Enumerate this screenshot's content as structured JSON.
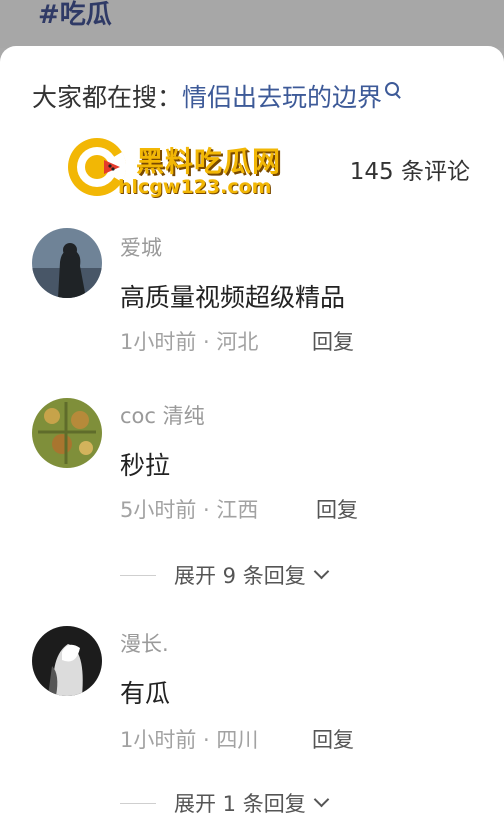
{
  "header": {
    "hashtag": "#吃瓜"
  },
  "search": {
    "prefix": "大家都在搜：",
    "term": "情侣出去玩的边界",
    "icon": "search-icon"
  },
  "watermark": {
    "name": "黑料吃瓜网",
    "url": "hlcgw123.com"
  },
  "comments_header": {
    "count_label": "145 条评论"
  },
  "comments": [
    {
      "username": "爱城",
      "text": "高质量视频超级精品",
      "meta": "1小时前 · 河北",
      "reply": "回复"
    },
    {
      "username": "coc 清纯",
      "text": "秒拉",
      "meta": "5小时前 · 江西",
      "reply": "回复",
      "expand": "展开 9 条回复"
    },
    {
      "username": "漫长.",
      "text": "有瓜",
      "meta": "1小时前 · 四川",
      "reply": "回复",
      "expand": "展开 1 条回复"
    }
  ],
  "colors": {
    "accent_link": "#3d5a98",
    "watermark_gold": "#f2b705",
    "muted_text": "#9a9a9a"
  }
}
